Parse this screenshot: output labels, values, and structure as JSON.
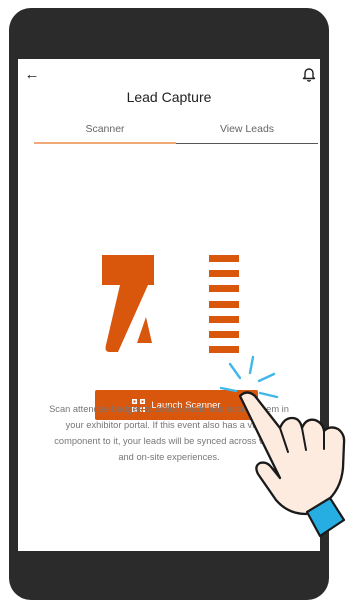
{
  "header": {
    "title": "Lead Capture",
    "back_icon": "arrow-left-icon",
    "bell_icon": "bell-icon"
  },
  "tabs": [
    {
      "label": "Scanner",
      "active": true
    },
    {
      "label": "View Leads",
      "active": false
    }
  ],
  "scanner": {
    "hero_icon": "barcode-scanner-icon",
    "launch_label": "Launch Scanner",
    "launch_icon": "qr-code-icon",
    "description_lines": [
      "Scan attendee badges to collect leads and access them in",
      "your exhibitor portal. If this event also has a virtual",
      "component to it, your leads will be synced across virtual",
      "and on-site experiences."
    ]
  },
  "overlay": {
    "hand_icon": "tapping-hand-icon"
  },
  "colors": {
    "accent": "#d9560d",
    "phone_frame": "#2b2b2b",
    "hand_fill": "#fdebe0",
    "cuff": "#26aee3",
    "tap_rays": "#3fb8e8"
  }
}
